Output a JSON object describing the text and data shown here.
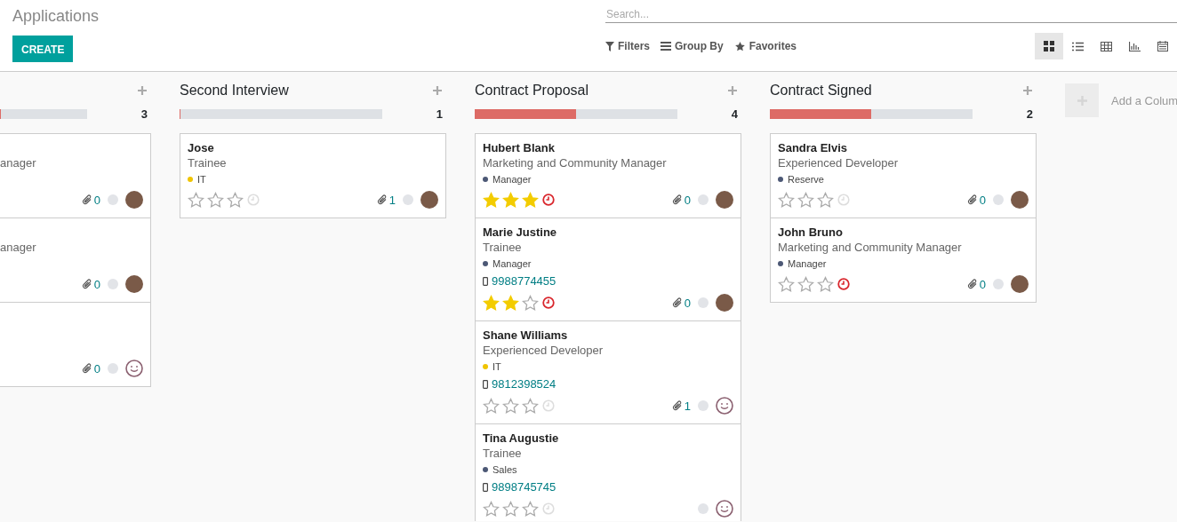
{
  "header": {
    "title": "Applications",
    "create_button": "CREATE",
    "search": {
      "placeholder": "Search..."
    },
    "filters": [
      {
        "kind": "filter",
        "label": "Filters"
      },
      {
        "kind": "group",
        "label": "Group By"
      },
      {
        "kind": "favorite",
        "label": "Favorites"
      }
    ],
    "views": [
      {
        "kind": "kanban",
        "selected": true
      },
      {
        "kind": "list",
        "selected": false
      },
      {
        "kind": "table",
        "selected": false
      },
      {
        "kind": "graph",
        "selected": false
      },
      {
        "kind": "calendar",
        "selected": false
      }
    ]
  },
  "columns": [
    {
      "partial": true,
      "count": "3",
      "level": 0,
      "cards": [
        {
          "job": "anager",
          "attachments": "0",
          "avatar": {
            "kind": "photo"
          }
        },
        {
          "job": "anager",
          "attachments": "0",
          "avatar": {
            "kind": "photo"
          }
        },
        {
          "attachments": "0",
          "avatar": {
            "kind": "smiley"
          }
        }
      ]
    },
    {
      "title": "Second Interview",
      "count": "1",
      "level": 0,
      "cards": [
        {
          "name": "Jose",
          "job": "Trainee",
          "tag": {
            "label": "IT",
            "color": "#f0c400"
          },
          "stars": 0,
          "activity": {
            "overdue": false
          },
          "attachments": "1",
          "avatar": {
            "kind": "photo"
          }
        }
      ]
    },
    {
      "title": "Contract Proposal",
      "count": "4",
      "level": 0.5,
      "cards": [
        {
          "name": "Hubert Blank",
          "job": "Marketing and Community Manager",
          "tag": {
            "label": "Manager",
            "color": "#4c5875"
          },
          "stars": 3,
          "activity": {
            "overdue": true
          },
          "attachments": "0",
          "avatar": {
            "kind": "photo"
          }
        },
        {
          "name": "Marie Justine",
          "job": "Trainee",
          "tag": {
            "label": "Manager",
            "color": "#4c5875"
          },
          "phone": "9988774455",
          "stars": 2,
          "activity": {
            "overdue": true
          },
          "attachments": "0",
          "avatar": {
            "kind": "photo"
          }
        },
        {
          "name": "Shane Williams",
          "job": "Experienced Developer",
          "tag": {
            "label": "IT",
            "color": "#f0c400"
          },
          "phone": "9812398524",
          "stars": 0,
          "activity": {
            "overdue": false
          },
          "attachments": "1",
          "avatar": {
            "kind": "smiley"
          }
        },
        {
          "name": "Tina Augustie",
          "job": "Trainee",
          "tag": {
            "label": "Sales",
            "color": "#4c5875"
          },
          "phone": "9898745745",
          "stars": 0,
          "activity": {
            "overdue": false
          },
          "avatar": {
            "kind": "smiley"
          }
        }
      ]
    },
    {
      "title": "Contract Signed",
      "count": "2",
      "level": 0.5,
      "cards": [
        {
          "name": "Sandra Elvis",
          "job": "Experienced Developer",
          "tag": {
            "label": "Reserve",
            "color": "#4c5875"
          },
          "stars": 0,
          "activity": {
            "overdue": false
          },
          "attachments": "0",
          "avatar": {
            "kind": "photo"
          }
        },
        {
          "name": "John Bruno",
          "job": "Marketing and Community Manager",
          "tag": {
            "label": "Manager",
            "color": "#4c5875"
          },
          "stars": 0,
          "activity": {
            "overdue": true
          },
          "attachments": "0",
          "avatar": {
            "kind": "photo"
          }
        }
      ]
    }
  ],
  "add_column": "Add a Colum"
}
